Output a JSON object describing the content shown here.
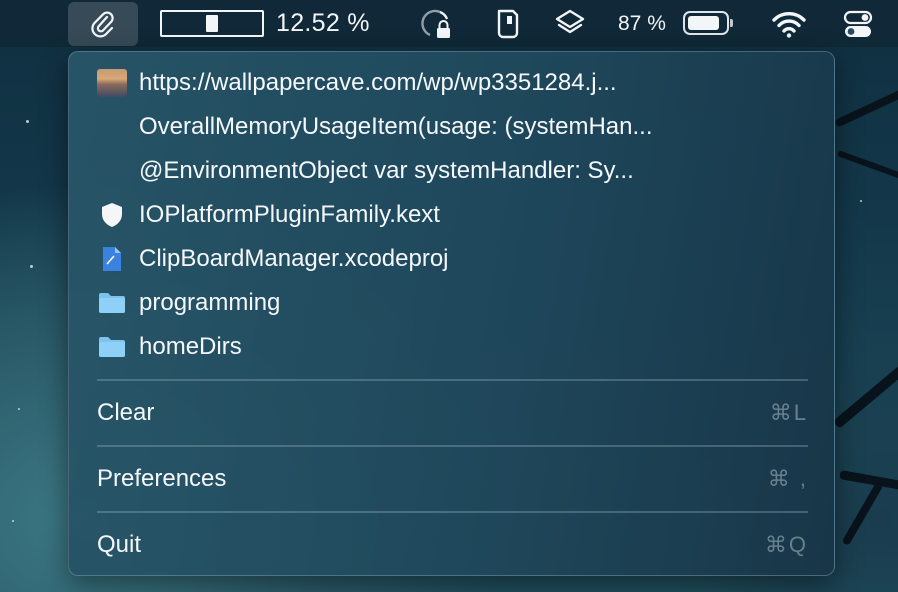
{
  "menubar": {
    "clipboard_icon": "paperclip-icon",
    "memory": {
      "text": "12.52 %",
      "fraction": 0.1252
    },
    "status_icons": [
      "memory-lock-icon",
      "phone-icon",
      "layers-icon"
    ],
    "battery": {
      "text": "87 %",
      "fraction": 0.87
    },
    "right_icons": [
      "wifi-icon",
      "control-center-icon"
    ]
  },
  "menu": {
    "items": [
      {
        "icon": "image-thumbnail-icon",
        "label": "https://wallpapercave.com/wp/wp3351284.j..."
      },
      {
        "icon": "",
        "label": "OverallMemoryUsageItem(usage: (systemHan..."
      },
      {
        "icon": "",
        "label": "@EnvironmentObject var systemHandler: Sy..."
      },
      {
        "icon": "shield-icon",
        "label": "IOPlatformPluginFamily.kext"
      },
      {
        "icon": "xcode-document-icon",
        "label": "ClipBoardManager.xcodeproj"
      },
      {
        "icon": "folder-icon",
        "label": "programming"
      },
      {
        "icon": "folder-icon",
        "label": "homeDirs"
      }
    ],
    "commands": [
      {
        "label": "Clear",
        "shortcut": "⌘L"
      },
      {
        "label": "Preferences",
        "shortcut": "⌘ ,"
      },
      {
        "label": "Quit",
        "shortcut": "⌘Q"
      }
    ]
  },
  "colors": {
    "menu_bg": "#265468",
    "text": "#f4f8fa",
    "shortcut": "#8fa6b0",
    "folder": "#7cc3ee",
    "xcode_doc": "#3b82e0"
  }
}
